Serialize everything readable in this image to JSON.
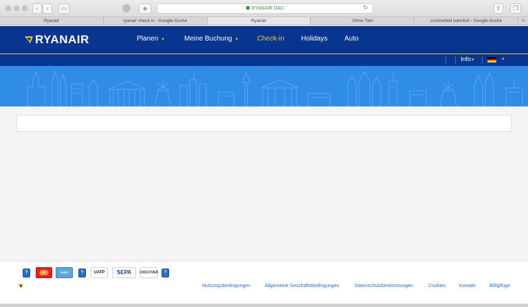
{
  "browser": {
    "url": "RYANAIR DAC",
    "tabs": [
      {
        "label": "Ryanair"
      },
      {
        "label": "ryanair check in - Google-Suche"
      },
      {
        "label": "Ryanair"
      },
      {
        "label": "Ohne Titel"
      },
      {
        "label": "schönefeld bahnhof - Google-Suche"
      }
    ],
    "new_tab": "+"
  },
  "header": {
    "logo": "RYANAIR",
    "nav": [
      {
        "label": "Planen",
        "dropdown": true
      },
      {
        "label": "Meine Buchung",
        "dropdown": true
      },
      {
        "label": "Check-in",
        "dropdown": false
      },
      {
        "label": "Holidays",
        "dropdown": false
      },
      {
        "label": "Auto",
        "dropdown": false
      }
    ],
    "info": "Info",
    "colors": {
      "brand_blue": "#073590",
      "accent_yellow": "#f1c931",
      "banner_blue": "#2f8de8"
    }
  },
  "footer": {
    "payment_methods": [
      "?",
      "MasterCard",
      "AMEX",
      "?",
      "UATP",
      "SEPA",
      "DISCOVER",
      "?"
    ],
    "links": [
      "Nutzungsbedingungen",
      "Allgemeine Geschäftsbedingungen",
      "Datenschutzbestimmungen",
      "Cookies",
      "Kontakt",
      "Billigflüge"
    ]
  }
}
